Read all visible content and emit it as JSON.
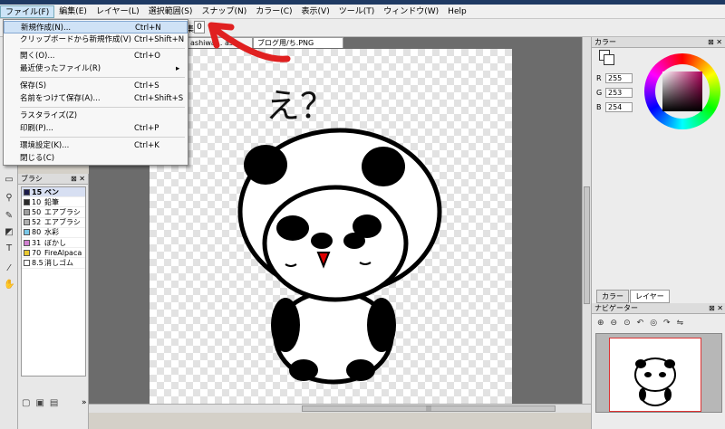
{
  "menubar": [
    "ファイル(F)",
    "編集(E)",
    "レイヤー(L)",
    "選択範囲(S)",
    "スナップ(N)",
    "カラー(C)",
    "表示(V)",
    "ツール(T)",
    "ウィンドウ(W)",
    "Help"
  ],
  "toolbar": {
    "label": "集",
    "field": "0"
  },
  "tabs": [
    "ashiwa... ask...",
    "ブログ用/ち.PNG"
  ],
  "file_menu": {
    "items": [
      {
        "label": "新規作成(N)...",
        "shortcut": "Ctrl+N"
      },
      {
        "label": "クリップボードから新規作成(V)",
        "shortcut": "Ctrl+Shift+N"
      },
      {
        "label": "開く(O)...",
        "shortcut": "Ctrl+O"
      },
      {
        "label": "最近使ったファイル(R)",
        "shortcut": "",
        "submenu": "▸"
      },
      {
        "label": "保存(S)",
        "shortcut": "Ctrl+S"
      },
      {
        "label": "名前をつけて保存(A)...",
        "shortcut": "Ctrl+Shift+S"
      },
      {
        "label": "ラスタライズ(Z)",
        "shortcut": ""
      },
      {
        "label": "印刷(P)...",
        "shortcut": "Ctrl+P"
      },
      {
        "label": "環境設定(K)...",
        "shortcut": "Ctrl+K"
      },
      {
        "label": "閉じる(C)",
        "shortcut": ""
      }
    ]
  },
  "brush_panel": {
    "title": "ブラシ",
    "brushes": [
      {
        "size": "15",
        "name": "ペン",
        "color": "#1a1a4a"
      },
      {
        "size": "10",
        "name": "鉛筆",
        "color": "#2a2a2a"
      },
      {
        "size": "50",
        "name": "エアブラシ",
        "color": "#a0a0a0"
      },
      {
        "size": "52",
        "name": "エアブラシ",
        "color": "#b0b0b0"
      },
      {
        "size": "80",
        "name": "水彩",
        "color": "#7ac8e8"
      },
      {
        "size": "31",
        "name": "ぼかし",
        "color": "#d080d0"
      },
      {
        "size": "70",
        "name": "FireAlpaca",
        "color": "#e8c830"
      },
      {
        "size": "8.5",
        "name": "消しゴム",
        "color": "#ffffff"
      }
    ]
  },
  "color_panel": {
    "title": "カラー",
    "r": "255",
    "g": "253",
    "b": "254"
  },
  "right_tabs": [
    "カラー",
    "レイヤー"
  ],
  "navigator": {
    "title": "ナビゲーター"
  },
  "canvas_text": "え？"
}
